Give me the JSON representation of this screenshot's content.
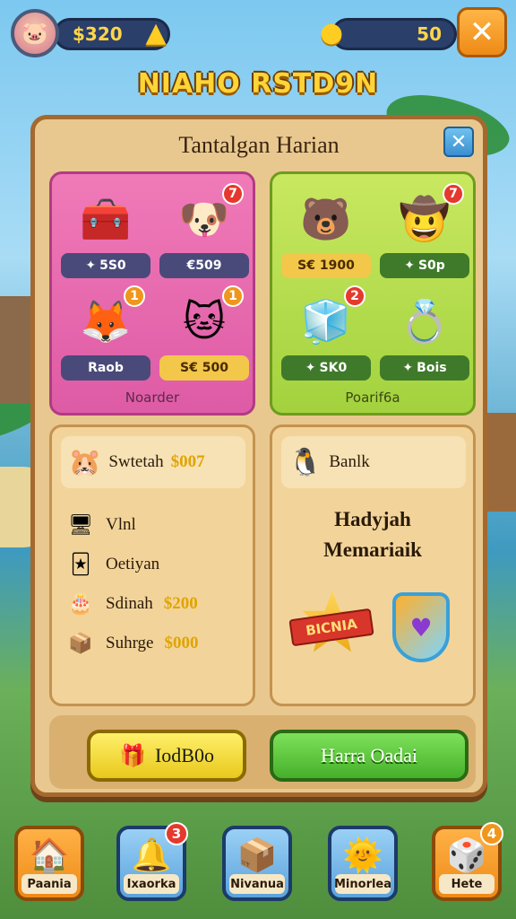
{
  "header": {
    "coins": "$320",
    "drops": "50",
    "title": "NIAHO RSTD9N"
  },
  "panel": {
    "title": "Tantalgan Harian",
    "pink_box": {
      "label": "Noarder",
      "items": [
        {
          "name": "treasure-machine",
          "price": "5S0",
          "badge": ""
        },
        {
          "name": "dog-pet",
          "price": "€509",
          "badge": "7"
        },
        {
          "name": "fox-pet",
          "price": "Raob",
          "badge": "1"
        },
        {
          "name": "cat-pet",
          "price": "S€ 500",
          "badge": "1"
        }
      ]
    },
    "green_box": {
      "label": "Poarif6a",
      "items": [
        {
          "name": "bear-pet",
          "price": "S€ 1900",
          "badge": ""
        },
        {
          "name": "cowboy-pet",
          "price": "S0p",
          "badge": "7"
        },
        {
          "name": "blue-chest",
          "price": "SK0",
          "badge": "2"
        },
        {
          "name": "gold-ring",
          "price": "Bois",
          "badge": ""
        }
      ]
    },
    "stats": {
      "head_label": "Swtetah",
      "head_value": "$007",
      "rows": [
        {
          "label": "Vlnl",
          "value": ""
        },
        {
          "label": "Oetiyan",
          "value": ""
        },
        {
          "label": "Sdinah",
          "value": "$200"
        },
        {
          "label": "Suhrge",
          "value": "$000"
        }
      ]
    },
    "gift": {
      "head_label": "Banlk",
      "title_line1": "Hadyjah",
      "title_line2": "Memariaik",
      "ribbon": "BICNIA"
    },
    "buttons": {
      "left": "IodB0o",
      "right": "Harra Oadai"
    }
  },
  "nav": [
    {
      "label": "Paania",
      "badge": "",
      "icon": "home-icon"
    },
    {
      "label": "Ixaorka",
      "badge": "3",
      "icon": "bell-icon"
    },
    {
      "label": "Nivanua",
      "badge": "",
      "icon": "crate-icon"
    },
    {
      "label": "Minorlea",
      "badge": "",
      "icon": "sun-pet-icon"
    },
    {
      "label": "Hete",
      "badge": "4",
      "icon": "dice-icon"
    }
  ]
}
